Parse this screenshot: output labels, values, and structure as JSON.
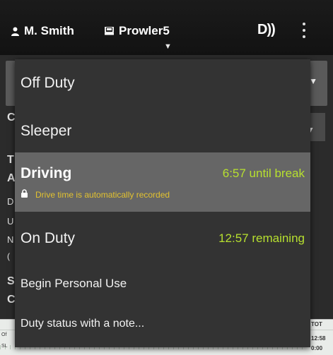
{
  "header": {
    "user_name": "M. Smith",
    "vehicle_name": "Prowler5",
    "user_icon": "person-icon",
    "vehicle_icon": "truck-icon",
    "beacon_icon_text": "D))",
    "menu_icon": "kebab-menu-icon"
  },
  "background": {
    "letters": [
      "C",
      "T",
      "A",
      "D",
      "U",
      "N",
      "(",
      "S",
      "C"
    ],
    "graph": {
      "tot_label": "TOT",
      "tot_value_1": "12:58",
      "tot_value_2": "0:00",
      "left_label_1": "Of",
      "left_label_2": "SL"
    }
  },
  "menu": {
    "items": [
      {
        "label": "Off Duty"
      },
      {
        "label": "Sleeper"
      },
      {
        "label": "Driving",
        "status": "6:57 until break",
        "note": "Drive time is automatically recorded",
        "selected": true
      },
      {
        "label": "On Duty",
        "status": "12:57 remaining"
      },
      {
        "label": "Begin Personal Use"
      },
      {
        "label": "Duty status with a note..."
      }
    ]
  },
  "colors": {
    "status_green": "#b7e02f",
    "note_yellow": "#e2c230",
    "selected_bg": "#666666",
    "menu_bg": "#333333"
  }
}
